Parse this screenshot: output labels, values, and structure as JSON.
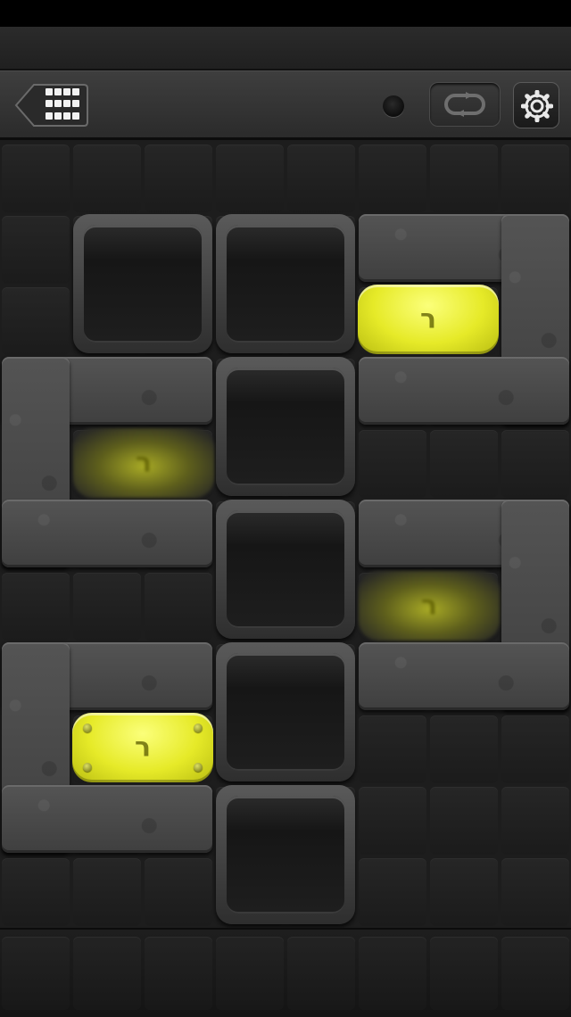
{
  "toolbar": {
    "back_icon": "level-grid-icon",
    "restart_icon": "restart-loop-icon",
    "settings_icon": "gear-icon"
  },
  "board": {
    "columns": 8,
    "rows": 11,
    "blocks": [
      {
        "id": "block-1",
        "state": "lit",
        "glyph": "ר"
      },
      {
        "id": "block-2",
        "state": "dim",
        "glyph": "ר"
      },
      {
        "id": "block-3",
        "state": "dim",
        "glyph": "ר"
      },
      {
        "id": "block-4",
        "state": "lit",
        "glyph": "ר",
        "riveted": true
      }
    ]
  },
  "colors": {
    "block_lit": "#e6ea28",
    "block_dim": "#5e5f1c",
    "wall": "#4a4a4a",
    "background": "#1d1d1d"
  }
}
